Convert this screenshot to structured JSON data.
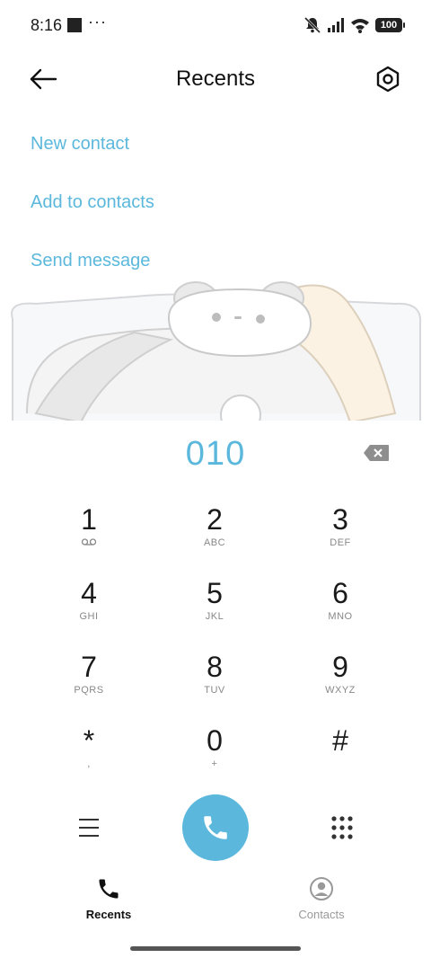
{
  "status_bar": {
    "time": "8:16",
    "more": "···",
    "battery": "100"
  },
  "header": {
    "title": "Recents",
    "back_icon": "arrow-left-icon",
    "settings_icon": "hexagon-settings-icon"
  },
  "actions": {
    "new_contact": "New contact",
    "add_to_contacts": "Add to contacts",
    "send_message": "Send message"
  },
  "dialer": {
    "number": "010",
    "keys": [
      {
        "digit": "1",
        "letters": ""
      },
      {
        "digit": "2",
        "letters": "ABC"
      },
      {
        "digit": "3",
        "letters": "DEF"
      },
      {
        "digit": "4",
        "letters": "GHI"
      },
      {
        "digit": "5",
        "letters": "JKL"
      },
      {
        "digit": "6",
        "letters": "MNO"
      },
      {
        "digit": "7",
        "letters": "PQRS"
      },
      {
        "digit": "8",
        "letters": "TUV"
      },
      {
        "digit": "9",
        "letters": "WXYZ"
      },
      {
        "digit": "*",
        "letters": ","
      },
      {
        "digit": "0",
        "letters": "+"
      },
      {
        "digit": "#",
        "letters": ""
      }
    ]
  },
  "bottom_nav": {
    "recents": "Recents",
    "contacts": "Contacts"
  },
  "colors": {
    "accent": "#5bb8dc",
    "text_primary": "#111111",
    "text_secondary": "#888888"
  }
}
